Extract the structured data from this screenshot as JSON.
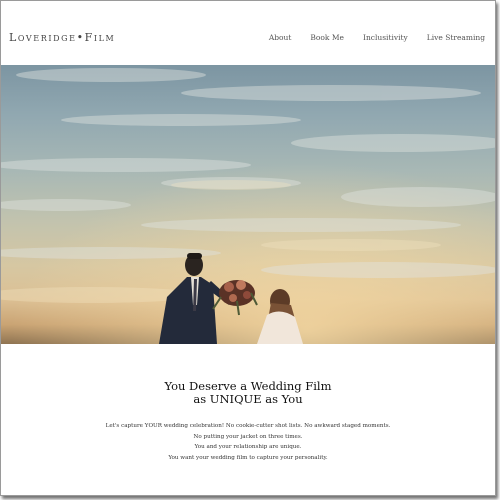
{
  "header": {
    "logo": "Loveridge•Film",
    "nav": [
      "About",
      "Book Me",
      "Inclusitivity",
      "Live Streaming"
    ]
  },
  "hero": {
    "sky_color_top": "#7c95a2",
    "sky_color_horizon": "#dcc094"
  },
  "intro": {
    "headline_line1": "You Deserve a Wedding Film",
    "headline_line2": "as UNIQUE as You",
    "lines": [
      "Let's capture YOUR wedding celebration! No cookie-cutter shot lists. No awkward staged moments.",
      "No putting your jacket on three times.",
      "You and your relationship are unique.",
      "You want your wedding film to capture your personality."
    ]
  }
}
